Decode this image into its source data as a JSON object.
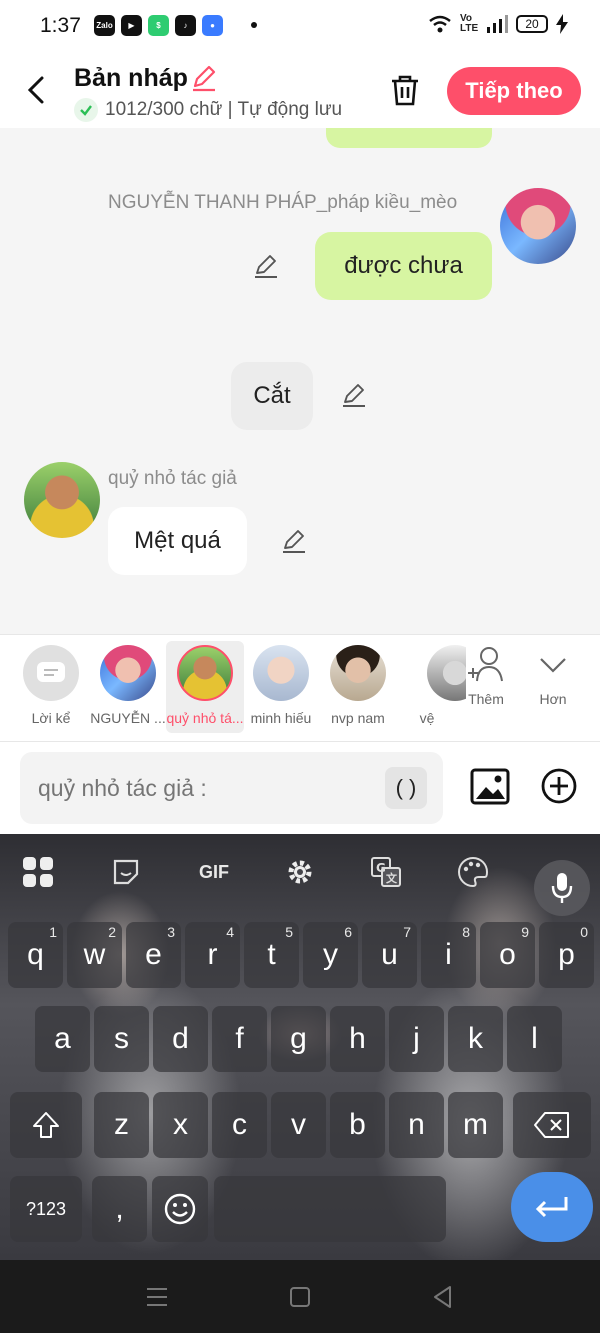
{
  "status_bar": {
    "time": "1:37",
    "apps": [
      "Zalo",
      "▶",
      "$",
      "♪",
      "●"
    ],
    "network": "Vo LTE",
    "battery": "20"
  },
  "header": {
    "title": "Bản nháp",
    "word_count": "1012/300 chữ | Tự động lưu",
    "next_label": "Tiếp theo",
    "accent_color": "#fe4f6a"
  },
  "messages": [
    {
      "sender": "NGUYỄN THANH PHÁP_pháp kiều_mèo",
      "text": "được chưa",
      "side": "right"
    },
    {
      "sender": "",
      "text": "Cắt",
      "side": "center"
    },
    {
      "sender": "quỷ nhỏ tác giả",
      "text": "Mệt quá",
      "side": "left"
    }
  ],
  "characters": [
    {
      "label": "Lời kể",
      "icon": "narrator-icon"
    },
    {
      "label": "NGUYỄN ...",
      "icon": "avatar"
    },
    {
      "label": "quỷ nhỏ tá...",
      "icon": "avatar",
      "active": true
    },
    {
      "label": "minh hiếu",
      "icon": "avatar"
    },
    {
      "label": "nvp nam",
      "icon": "avatar"
    },
    {
      "label": "vệ",
      "icon": "avatar"
    },
    {
      "label": "Thêm",
      "icon": "add-person-icon"
    },
    {
      "label": "Hơn",
      "icon": "chevron-down-icon"
    }
  ],
  "composer": {
    "placeholder": "quỷ nhỏ tác giả :",
    "paren": "( )"
  },
  "keyboard": {
    "toolbar": [
      "apps-icon",
      "sticker-icon",
      "GIF",
      "gear-icon",
      "translate-icon",
      "palette-icon",
      "mic-icon"
    ],
    "gif_label": "GIF",
    "row1": [
      {
        "key": "q",
        "hint": "1"
      },
      {
        "key": "w",
        "hint": "2"
      },
      {
        "key": "e",
        "hint": "3"
      },
      {
        "key": "r",
        "hint": "4"
      },
      {
        "key": "t",
        "hint": "5"
      },
      {
        "key": "y",
        "hint": "6"
      },
      {
        "key": "u",
        "hint": "7"
      },
      {
        "key": "i",
        "hint": "8"
      },
      {
        "key": "o",
        "hint": "9"
      },
      {
        "key": "p",
        "hint": "0"
      }
    ],
    "row2": [
      "a",
      "s",
      "d",
      "f",
      "g",
      "h",
      "j",
      "k",
      "l"
    ],
    "row3": [
      "z",
      "x",
      "c",
      "v",
      "b",
      "n",
      "m"
    ],
    "symbols_label": "?123",
    "comma": ",",
    "emoji_icon": "emoji-icon",
    "enter_icon": "enter-icon",
    "enter_color": "#4a8fe8"
  },
  "navigation": [
    "menu-icon",
    "home-icon",
    "back-icon"
  ]
}
